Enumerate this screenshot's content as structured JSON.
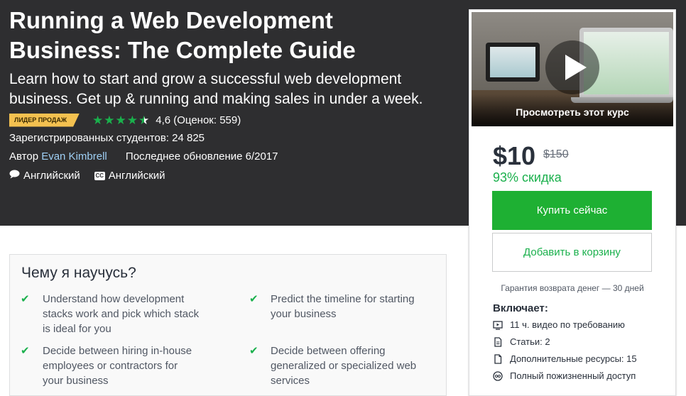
{
  "hero": {
    "title_line1": "Running a Web Development",
    "title_line2": "Business: The Complete Guide",
    "subtitle_line1": "Learn how to start and grow a successful web development",
    "subtitle_line2": "business. Get up & running and making sales in under a week.",
    "badge": "ЛИДЕР ПРОДАЖ",
    "rating_value": 4.6,
    "rating_text": "4,6 (Оценок: 559)",
    "students": "Зарегистрированных студентов: 24 825",
    "author_label": "Автор",
    "author_name": "Evan Kimbrell",
    "last_updated": "Последнее обновление 6/2017",
    "language_audio": "Английский",
    "cc_icon_text": "CC",
    "language_subtitles": "Английский"
  },
  "learn": {
    "title": "Чему я научусь?",
    "items": [
      {
        "lines": [
          "Understand how development",
          "stacks work and pick which stack",
          "is ideal for you"
        ]
      },
      {
        "lines": [
          "Predict the timeline for starting",
          "your business"
        ]
      },
      {
        "lines": [
          "Decide between hiring in-house",
          "employees or contractors for",
          "your business"
        ]
      },
      {
        "lines": [
          "Decide between offering",
          "generalized or specialized web",
          "services"
        ]
      }
    ]
  },
  "sidebar": {
    "preview_label": "Просмотреть этот курс",
    "price": "$10",
    "old_price": "$150",
    "discount": "93% скидка",
    "buy_label": "Купить сейчас",
    "cart_label": "Добавить в корзину",
    "guarantee": "Гарантия возврата денег — 30 дней",
    "includes_title": "Включает:",
    "includes": [
      {
        "icon": "video-icon",
        "label": "11 ч. видео по требованию"
      },
      {
        "icon": "article-icon",
        "label": "Статьи: 2"
      },
      {
        "icon": "resource-icon",
        "label": "Дополнительные ресурсы: 15"
      },
      {
        "icon": "infinity-icon",
        "label": "Полный пожизненный доступ"
      }
    ]
  },
  "colors": {
    "hero_bg": "#2e2e30",
    "accent_green": "#1eb033",
    "badge_yellow": "#f4c150",
    "link_blue": "#9fd0f5"
  }
}
